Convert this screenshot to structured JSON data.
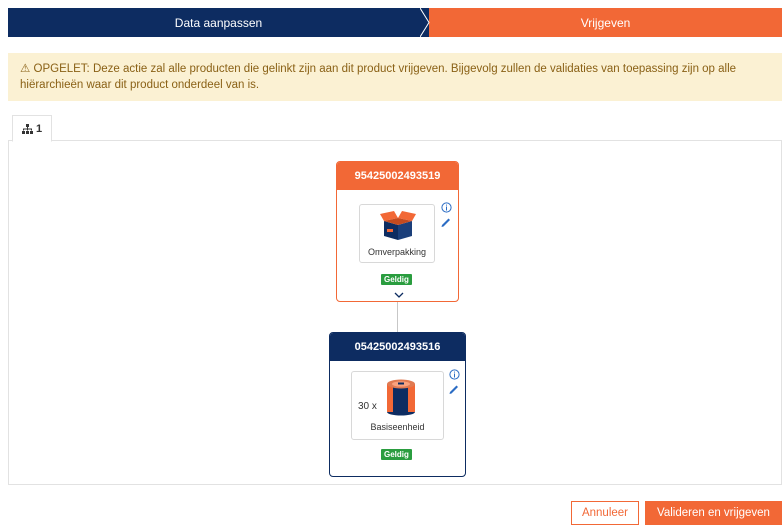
{
  "stepper": {
    "step1_label": "Data aanpassen",
    "step2_label": "Vrijgeven",
    "step1_color": "#0d2c61",
    "step2_color": "#f26836"
  },
  "warning": {
    "icon": "warning-triangle-icon",
    "text": "⚠ OPGELET: Deze actie zal alle producten die gelinkt zijn aan dit product vrijgeven. Bijgevolg zullen de validaties van toepassing zijn op alle hiërarchieën waar dit product onderdeel van is."
  },
  "tabs": [
    {
      "icon": "hierarchy-icon",
      "label": "1"
    }
  ],
  "hierarchy": {
    "parent": {
      "code": "95425002493519",
      "type_label": "Omverpakking",
      "status": "Geldig",
      "icon": "open-box-icon",
      "header_color": "#f26836"
    },
    "child": {
      "code": "05425002493516",
      "quantity": "30 x",
      "type_label": "Basiseenheid",
      "status": "Geldig",
      "icon": "can-icon",
      "header_color": "#0d2c61"
    }
  },
  "buttons": {
    "cancel": "Annuleer",
    "confirm": "Valideren en vrijgeven"
  }
}
